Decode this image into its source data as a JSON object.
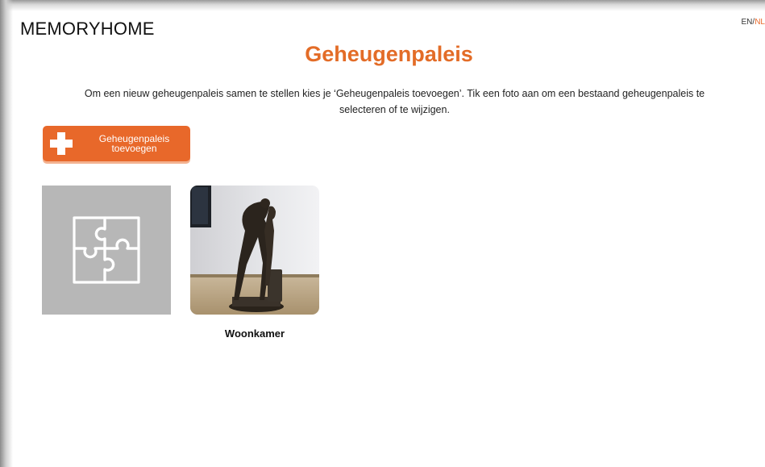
{
  "app": {
    "brand": "MEMORYHOME",
    "lang_en": "EN",
    "lang_sep": "/",
    "lang_nl": "NL"
  },
  "page": {
    "title": "Geheugenpaleis",
    "intro": "Om een nieuw geheugenpaleis samen te stellen kies je ‘Geheugenpaleis toevoegen’. Tik een foto aan om een bestaand geheugenpaleis te selecteren of te wijzigen."
  },
  "add_button": {
    "line1": "Geheugenpaleis",
    "line2": "toevoegen",
    "icon": "plus-icon"
  },
  "palaces": [
    {
      "name": "",
      "image": "puzzle-icon"
    },
    {
      "name": "Woonkamer",
      "image": "statue-photo"
    }
  ],
  "colors": {
    "accent": "#e36c27",
    "button": "#e8682a",
    "placeholder_bg": "#b7b7b7"
  }
}
